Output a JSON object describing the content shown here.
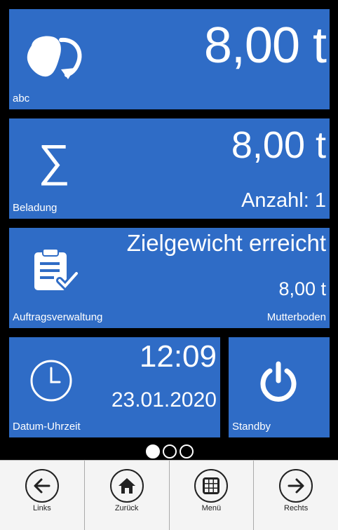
{
  "tile_weight": {
    "value": "8,00 t",
    "label": "abc",
    "icon": "truck-load-rotate-icon"
  },
  "tile_loading": {
    "value": "8,00 t",
    "count": "Anzahl: 1",
    "label": "Beladung",
    "icon": "sigma-icon",
    "sigma": "∑"
  },
  "tile_orders": {
    "status": "Zielgewicht erreicht",
    "weight": "8,00 t",
    "label": "Auftragsverwaltung",
    "material": "Mutterboden",
    "icon": "clipboard-check-icon"
  },
  "tile_datetime": {
    "time": "12:09",
    "date": "23.01.2020",
    "label": "Datum-Uhrzeit",
    "icon": "clock-icon"
  },
  "tile_standby": {
    "label": "Standby",
    "icon": "power-icon"
  },
  "pager": {
    "pages": 3,
    "active": 0
  },
  "nav": [
    {
      "label": "Links",
      "icon": "arrow-left-icon"
    },
    {
      "label": "Zurück",
      "icon": "home-icon"
    },
    {
      "label": "Menü",
      "icon": "grid-menu-icon"
    },
    {
      "label": "Rechts",
      "icon": "arrow-right-icon"
    }
  ],
  "colors": {
    "tile": "#2f6cc6",
    "background": "#000000",
    "navbar": "#f4f4f4"
  }
}
